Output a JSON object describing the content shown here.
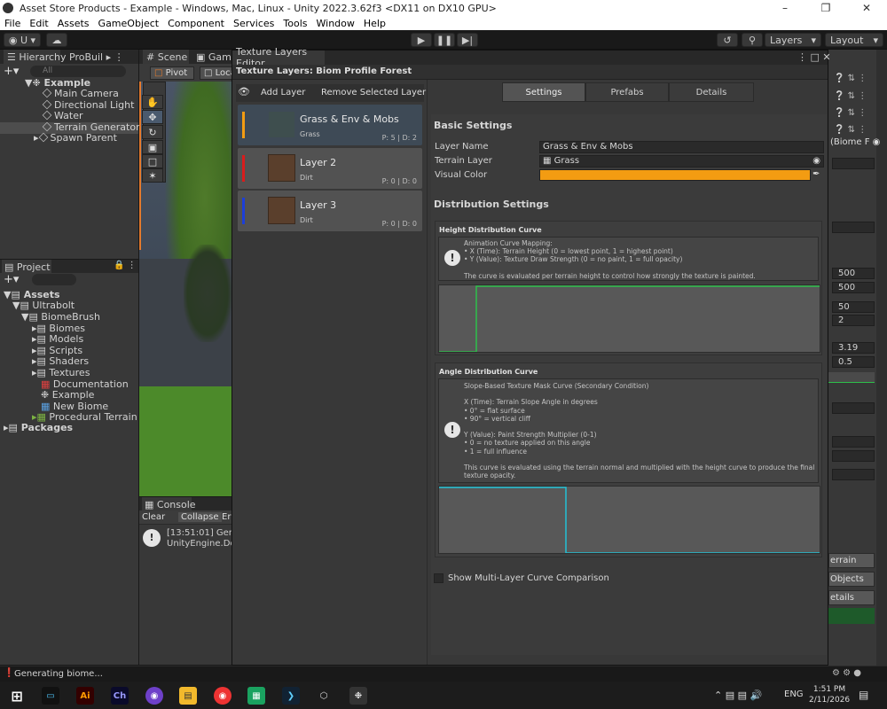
{
  "titlebar": {
    "title": "Asset Store Products - Example - Windows, Mac, Linux - Unity 2022.3.62f3 <DX11 on DX10 GPU>"
  },
  "menu": [
    "File",
    "Edit",
    "Assets",
    "GameObject",
    "Component",
    "Services",
    "Tools",
    "Window",
    "Help"
  ],
  "toolbar": {
    "account": "U",
    "layers": "Layers",
    "layout": "Layout"
  },
  "hierarchy": {
    "tab": "Hierarchy",
    "tab2": "ProBuil",
    "search_placeholder": "All",
    "scene": "Example",
    "items": [
      "Main Camera",
      "Directional Light",
      "Water",
      "Terrain Generator",
      "Spawn Parent"
    ]
  },
  "scene_tabs": {
    "scene": "Scene",
    "game": "Game",
    "pivot": "Pivot",
    "local": "Loca"
  },
  "project": {
    "tab": "Project",
    "assets": "Assets",
    "ultrabolt": "Ultrabolt",
    "biomebrush": "BiomeBrush",
    "items": [
      "Biomes",
      "Models",
      "Scripts",
      "Shaders",
      "Textures",
      "Documentation",
      "Example",
      "New Biome",
      "Procedural Terrain"
    ],
    "packages": "Packages"
  },
  "console": {
    "tab": "Console",
    "clear": "Clear",
    "collapse": "Collapse",
    "error": "Err",
    "log1": "[13:51:01] Gener",
    "log2": "UnityEngine.Deb"
  },
  "status": {
    "text": "Generating biome..."
  },
  "editor": {
    "window_tab": "Texture Layers Editor",
    "header": "Texture Layers: Biom Profile Forest",
    "add_layer": "Add Layer",
    "remove_layer": "Remove Selected Layer",
    "layers": [
      {
        "name": "Grass & Env & Mobs",
        "sub": "Grass",
        "pd": "P: 5 | D: 2",
        "color": "#f39c12"
      },
      {
        "name": "Layer 2",
        "sub": "Dirt",
        "pd": "P: 0 | D: 0",
        "color": "#d91c1c"
      },
      {
        "name": "Layer 3",
        "sub": "Dirt",
        "pd": "P: 0 | D: 0",
        "color": "#1c3fd9"
      }
    ],
    "tabs": [
      "Settings",
      "Prefabs",
      "Details"
    ],
    "basic": "Basic Settings",
    "layer_name_label": "Layer Name",
    "layer_name": "Grass & Env & Mobs",
    "terrain_layer_label": "Terrain Layer",
    "terrain_layer": "Grass",
    "visual_color_label": "Visual Color",
    "visual_color": "#f39c12",
    "distribution": "Distribution Settings",
    "height_title": "Height Distribution Curve",
    "height_help": "Animation Curve Mapping:\n• X (Time): Terrain Height (0 = lowest point, 1 = highest point)\n• Y (Value): Texture Draw Strength (0 = no paint, 1 = full opacity)\n\nThe curve is evaluated per terrain height to control how strongly the texture is painted.",
    "angle_title": "Angle Distribution Curve",
    "angle_help": "Slope-Based Texture Mask Curve (Secondary Condition)\n\nX (Time): Terrain Slope Angle in degrees\n• 0° = flat surface\n• 90° = vertical cliff\n\nY (Value): Paint Strength Multiplier (0-1)\n• 0 = no texture applied on this angle\n• 1 = full influence\n\nThis curve is evaluated using the terrain normal and multiplied with the height curve to produce the final\ntexture opacity.",
    "compare": "Show Multi-Layer Curve Comparison"
  },
  "inspector": {
    "biome": "(Biome F",
    "values": [
      "500",
      "500",
      "50",
      "2",
      "3.19",
      "0.5"
    ],
    "btn1": "errain",
    "btn2": "Objects",
    "btn3": "etails"
  },
  "taskbar": {
    "lang": "ENG",
    "time": "1:51 PM",
    "date": "2/11/2026"
  }
}
